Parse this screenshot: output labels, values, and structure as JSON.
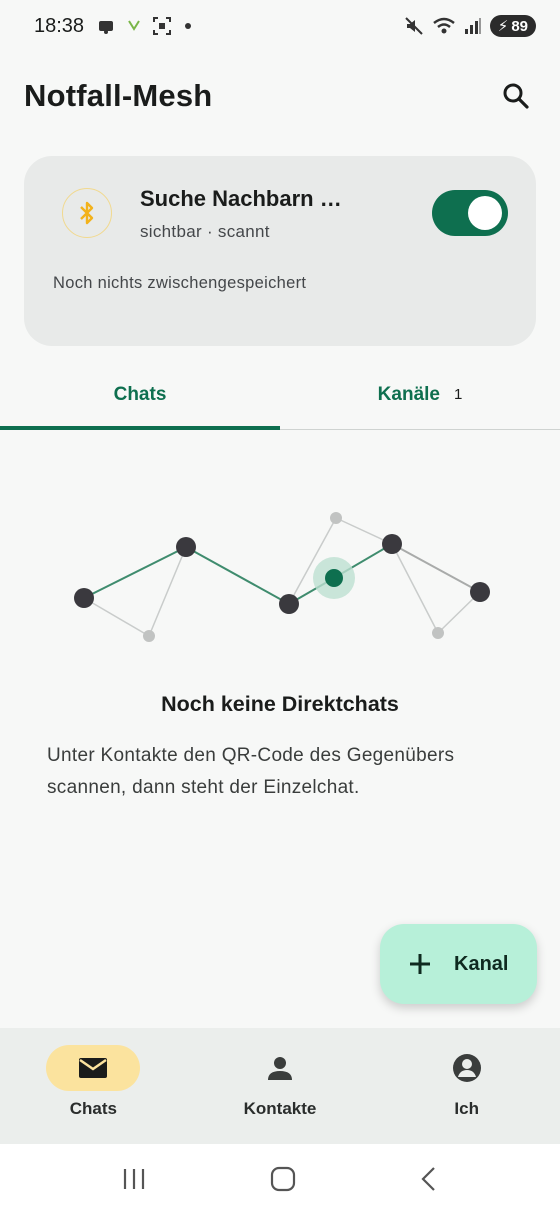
{
  "status_bar": {
    "time": "18:38",
    "battery": "89"
  },
  "app": {
    "title": "Notfall-Mesh"
  },
  "mesh_card": {
    "title": "Suche Nachbarn …",
    "subtitle": "sichtbar · scannt",
    "note": "Noch nichts zwischengespeichert",
    "toggle_on": true,
    "icon": "bluetooth-icon",
    "accent_color": "#0e6f4f"
  },
  "tabs": [
    {
      "label": "Chats",
      "badge": "",
      "active": true
    },
    {
      "label": "Kanäle",
      "badge": "1",
      "active": false
    }
  ],
  "empty_state": {
    "title": "Noch keine Direktchats",
    "text": "Unter Kontakte den QR-Code des Gegenübers scannen, dann steht der Einzelchat."
  },
  "fab": {
    "label": "Kanal",
    "icon": "plus-icon"
  },
  "bottom_nav": [
    {
      "label": "Chats",
      "icon": "mail-icon",
      "active": true
    },
    {
      "label": "Kontakte",
      "icon": "person-icon",
      "active": false
    },
    {
      "label": "Ich",
      "icon": "account-circle-icon",
      "active": false
    }
  ],
  "system_nav": [
    "recents-icon",
    "home-icon",
    "back-icon"
  ]
}
